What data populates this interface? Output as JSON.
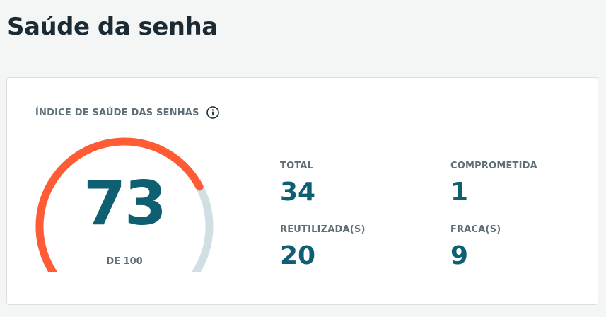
{
  "page": {
    "title": "Saúde da senha"
  },
  "health_card": {
    "label": "ÍNDICE DE SAÚDE DAS SENHAS",
    "info_icon": "info-icon",
    "score": "73",
    "score_fraction": 0.73,
    "score_max_label": "DE 100",
    "colors": {
      "gauge_fill": "#ff5b35",
      "gauge_track": "#cfdfe3",
      "value_text": "#0f5f73"
    }
  },
  "stats": {
    "total": {
      "label": "TOTAL",
      "value": "34"
    },
    "compromised": {
      "label": "COMPROMETIDA",
      "value": "1"
    },
    "reused": {
      "label": "REUTILIZADA(S)",
      "value": "20"
    },
    "weak": {
      "label": "FRACA(S)",
      "value": "9"
    }
  }
}
